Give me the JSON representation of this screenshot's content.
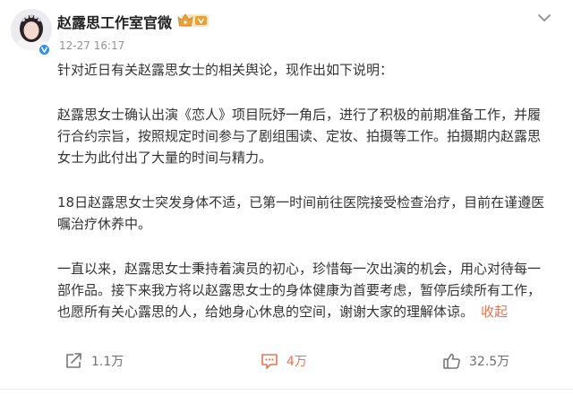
{
  "post": {
    "author": "赵露思工作室官微",
    "timestamp": "12-27 16:17",
    "paragraphs": [
      [
        "针对近日有关赵露思女士的相关舆论，现作出如下说明："
      ],
      [
        "赵露思女士确认出演《恋人》项目阮妤一角后，进行了积极的前期准备工作，并履",
        "行合约宗旨，按照规定时间参与了剧组围读、定妆、拍摄等工作。拍摄期内赵露思",
        "女士为此付出了大量的时间与精力。"
      ],
      [
        "18日赵露思女士突发身体不适，已第一时间前往医院接受检查治疗，目前在谨遵医",
        "嘱治疗休养中。"
      ],
      [
        "一直以来，赵露思女士秉持着演员的初心，珍惜每一次出演的机会，用心对待每一",
        "部作品。接下来我方将以赵露思女士的身体健康为首要考虑，暂停后续所有工作，",
        "也愿所有关心露思的人，给她身心休息的空间，谢谢大家的理解体谅。"
      ]
    ],
    "collapse_label": "收起"
  },
  "actions": {
    "forward_count": "1.1万",
    "comment_count": "4万",
    "like_count": "32.5万"
  },
  "icons": {
    "verified": "verified-v-icon",
    "badge": "crown-level-badge-icon",
    "menu": "chevron-down-icon",
    "forward": "share-forward-icon",
    "comment": "comment-icon",
    "like": "thumb-up-icon"
  },
  "colors": {
    "accent": "#eb7350",
    "verified": "#2f8ded",
    "badge_gold": "#e6a23c",
    "text": "#333333",
    "muted": "#939393"
  }
}
